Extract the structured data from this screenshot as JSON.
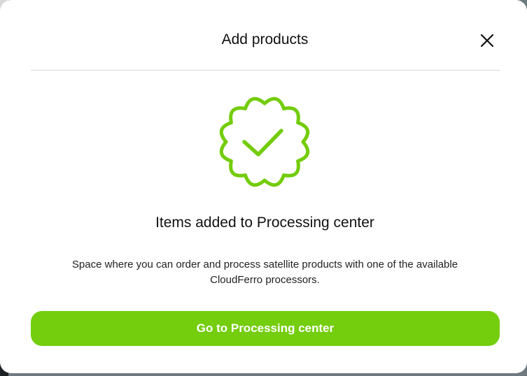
{
  "modal": {
    "title": "Add products",
    "close_icon": "close-icon",
    "success_icon": "badge-check-icon",
    "success_title": "Items added to Processing center",
    "description_line1": "Space where you can order and process satellite products with one of the available",
    "description_line2": "CloudFerro processors.",
    "primary_button_label": "Go to Processing center"
  },
  "colors": {
    "accent": "#74CD0D",
    "icon_stroke": "#73CC0A",
    "text": "#111111",
    "divider": "#D6D6D6"
  }
}
